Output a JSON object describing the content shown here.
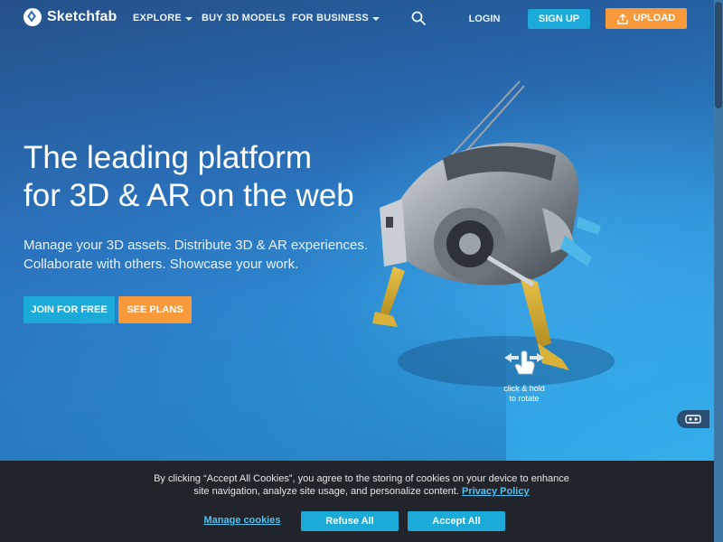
{
  "nav": {
    "brand": "Sketchfab",
    "explore": "EXPLORE",
    "buy": "BUY 3D MODELS",
    "business": "FOR BUSINESS",
    "login": "LOGIN",
    "signup": "SIGN UP",
    "upload": "UPLOAD"
  },
  "hero": {
    "headline_line1": "The leading platform",
    "headline_line2": "for 3D & AR on the web",
    "sub_line1": "Manage your 3D assets. Distribute 3D & AR experiences.",
    "sub_line2": "Collaborate with others. Showcase your work.",
    "join": "JOIN FOR FREE",
    "plans": "SEE PLANS"
  },
  "viewer": {
    "hint_line1": "click & hold",
    "hint_line2": "to rotate"
  },
  "cookie": {
    "text_line1": "By clicking “Accept All Cookies”, you agree to the storing of cookies on your device to enhance",
    "text_line2": "site navigation, analyze site usage, and personalize content.",
    "privacy": "Privacy Policy",
    "manage": "Manage cookies",
    "refuse": "Refuse All",
    "accept": "Accept All"
  },
  "colors": {
    "primary": "#1caad9",
    "accent": "#f89a3b",
    "banner": "#21252b",
    "link": "#4fc1f1"
  },
  "icons": [
    "sketchfab-logo-icon",
    "chevron-down-icon",
    "search-icon",
    "upload-icon",
    "hand-pointer-icon",
    "rotate-arrows-icon",
    "vr-icon"
  ]
}
